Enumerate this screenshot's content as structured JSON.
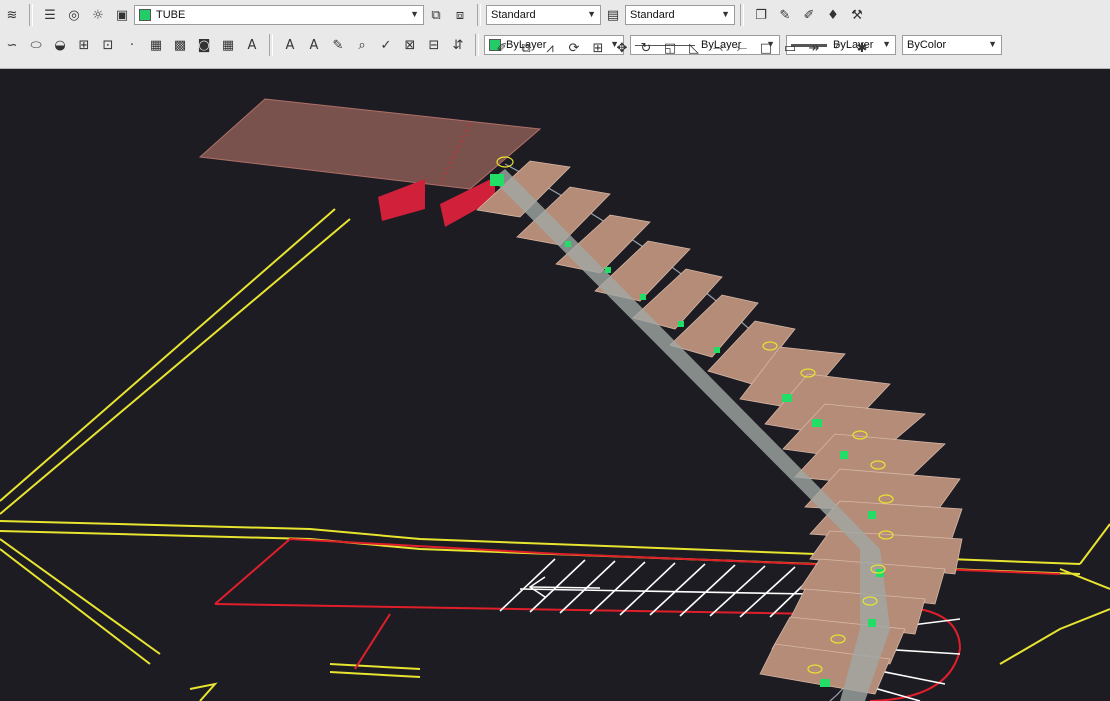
{
  "toolbar": {
    "layer_name": "TUBE",
    "text_style": "Standard",
    "dim_style": "Standard",
    "color": "ByLayer",
    "linetype": "ByLayer",
    "lineweight": "ByLayer",
    "plot_style": "ByColor",
    "text_tool_a": "A",
    "text_tool_multiline": "A",
    "text_tool_style": "A",
    "layer_color": "#22cc66"
  },
  "drawing": {
    "stair_tread_color": "#b48c78",
    "landing_color": "#8a5a55",
    "support_red": "#d0203a",
    "wall_yellow": "#e8e430",
    "hatch_red": "#e01f2b",
    "background": "#1c1c22"
  }
}
